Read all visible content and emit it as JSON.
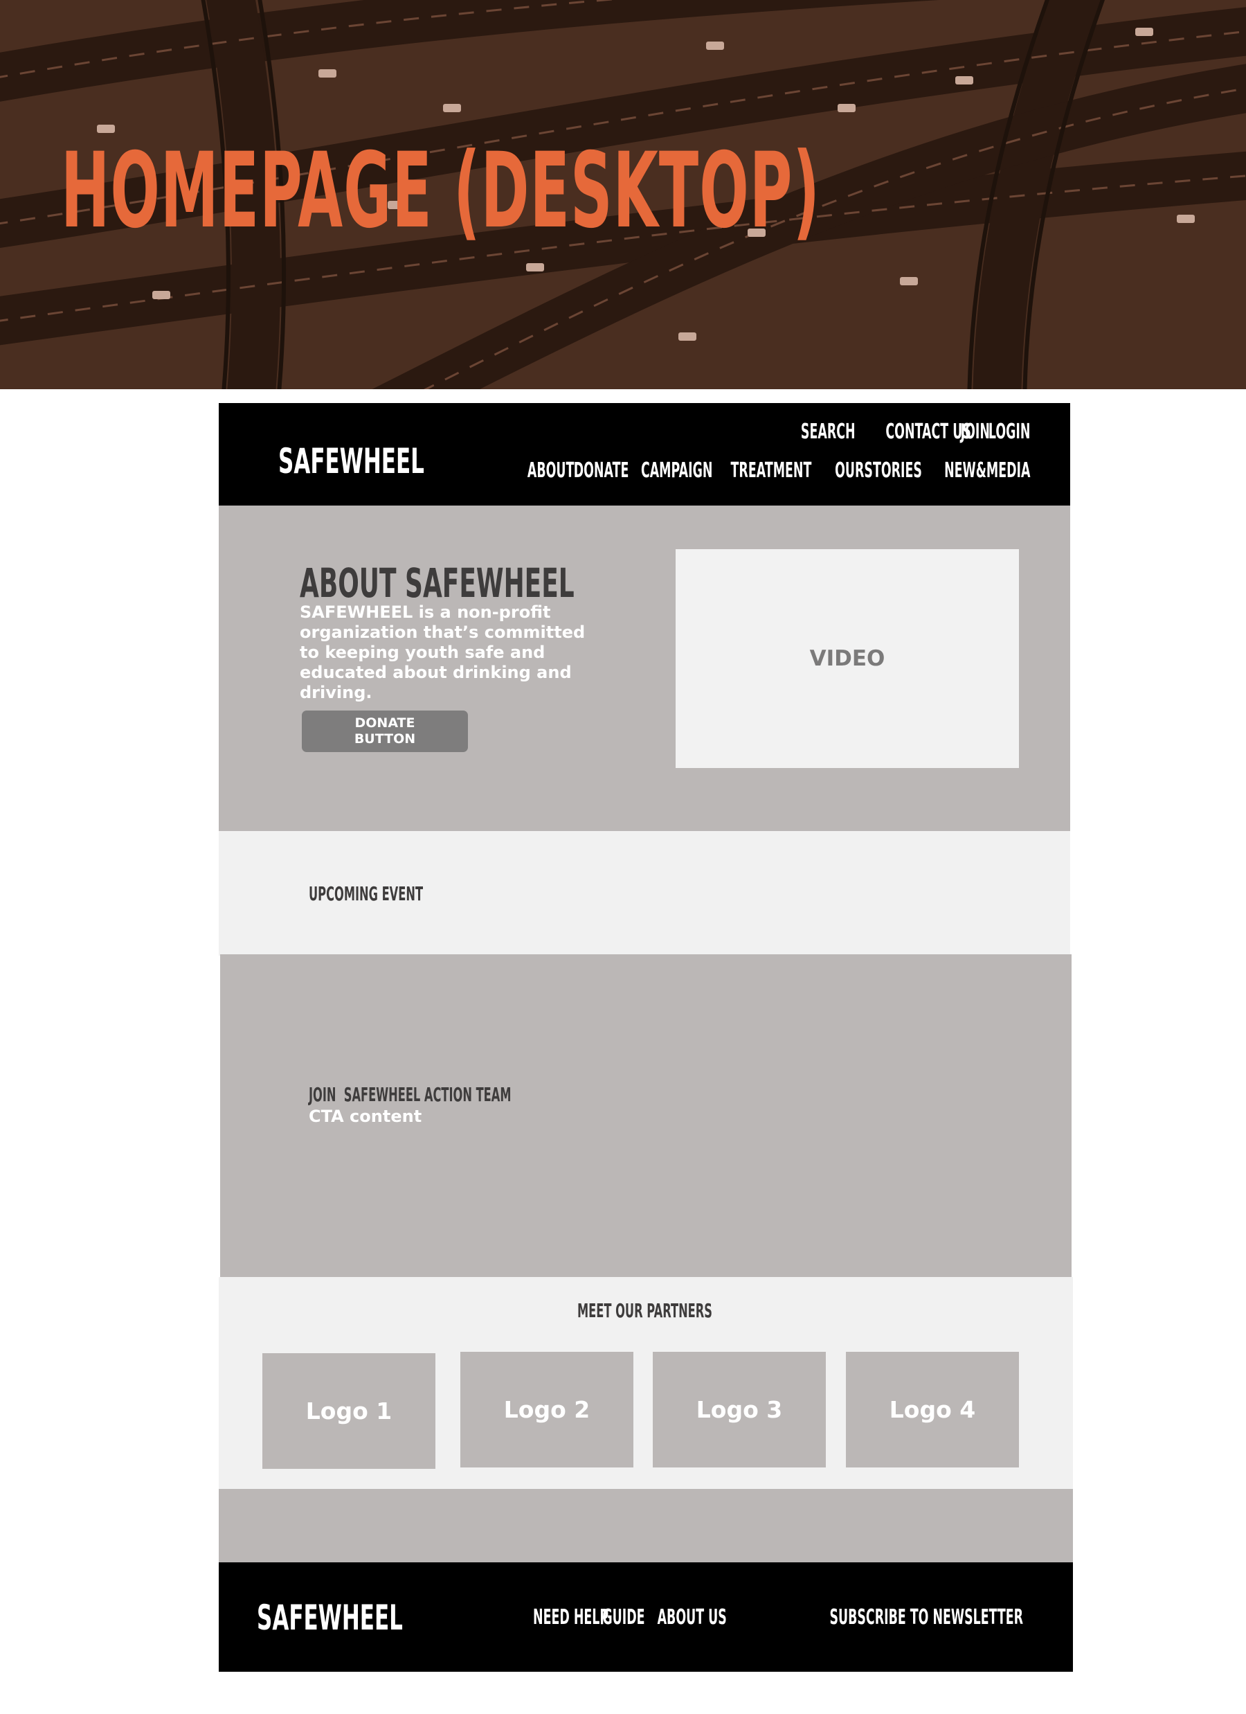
{
  "hero": {
    "title": "HOMEPAGE (DESKTOP)"
  },
  "header": {
    "logo": "SAFEWHEEL",
    "util_nav": [
      "SEARCH",
      "CONTACT US",
      "JOIN",
      "LOGIN"
    ],
    "main_nav": [
      "ABOUT",
      "DONATE",
      "CAMPAIGN",
      "TREATMENT",
      "OURSTORIES",
      "NEW&MEDIA"
    ]
  },
  "about": {
    "title": "ABOUT SAFEWHEEL",
    "text": "SAFEWHEEL is a non-profit organization that’s committed to keeping youth safe and educated about drinking and driving.",
    "donate_button": [
      "DONATE",
      "BUTTON"
    ],
    "video_label": "VIDEO"
  },
  "events": {
    "title": "UPCOMING EVENT"
  },
  "cta": {
    "title": "JOIN  SAFEWHEEL ACTION TEAM",
    "content": "CTA content"
  },
  "partners": {
    "title": "MEET OUR PARTNERS",
    "logos": [
      "Logo 1",
      "Logo 2",
      "Logo 3",
      "Logo 4"
    ]
  },
  "footer": {
    "logo": "SAFEWHEEL",
    "nav": [
      "NEED HELP",
      "GUIDE",
      "ABOUT US",
      "SUBSCRIBE TO NEWSLETTER"
    ]
  },
  "colors": {
    "accent": "#e6693a",
    "wire_gray": "#bbb7b6",
    "light_gray": "#f1f1f1",
    "black": "#000000"
  }
}
